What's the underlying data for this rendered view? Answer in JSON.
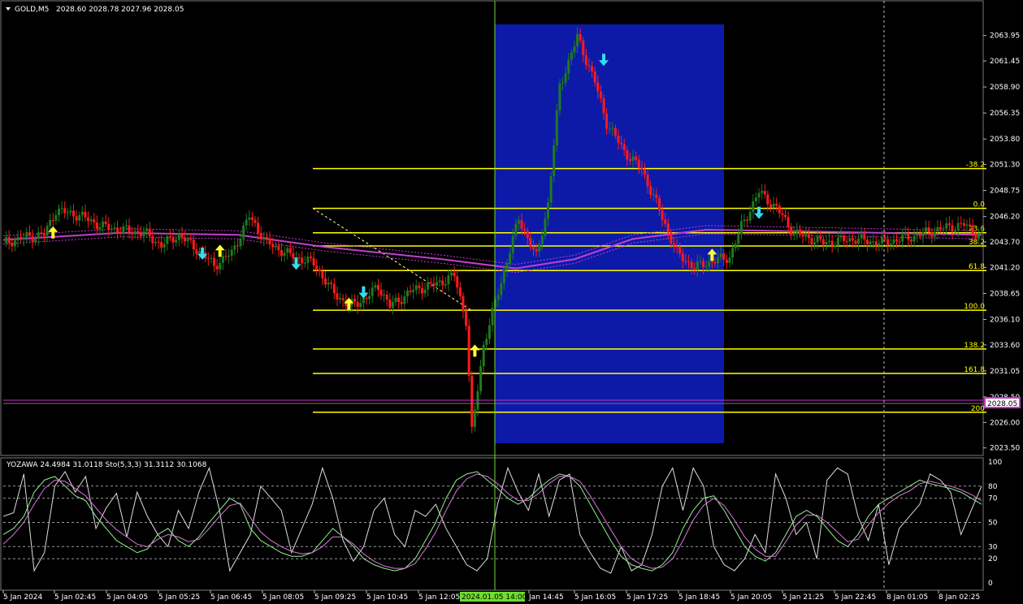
{
  "header": {
    "symbol_label": "GOLD,M5",
    "ohlc": "2028.60 2028.78 2027.96 2028.05"
  },
  "indicator": {
    "label": "YOZAWA 24.4984 31.0118  Sto(5,3,3) 31.3112 30.1068"
  },
  "price_badge": "2028.05",
  "colors": {
    "background": "#000000",
    "bull": "#1f7a1f",
    "bear": "#ff1a1a",
    "fib": "#ffff00",
    "box": "#0d1aa8",
    "ma": "#c040d0",
    "arrow_up": "#ffff33",
    "arrow_down": "#33ddee",
    "badge": "#cc33cc"
  },
  "chart_data": [
    {
      "type": "candlestick",
      "title": "GOLD,M5",
      "y_ticks": [
        "2063.95",
        "2061.45",
        "2058.90",
        "2056.35",
        "2053.80",
        "2051.30",
        "2048.75",
        "2046.20",
        "2043.70",
        "2041.20",
        "2038.65",
        "2036.10",
        "2033.60",
        "2031.05",
        "2028.50",
        "2026.00",
        "2023.50"
      ],
      "ylim": [
        2023.0,
        2065.2
      ],
      "x_ticks": [
        "5 Jan 2024",
        "5 Jan 02:45",
        "5 Jan 04:05",
        "5 Jan 05:25",
        "5 Jan 06:45",
        "5 Jan 08:05",
        "5 Jan 09:25",
        "5 Jan 10:45",
        "5 Jan 12:05",
        "2024.01.05 14:00",
        "Jan 14:45",
        "5 Jan 16:05",
        "5 Jan 17:25",
        "5 Jan 18:45",
        "5 Jan 20:05",
        "5 Jan 21:25",
        "5 Jan 22:45",
        "8 Jan 01:05",
        "8 Jan 02:25"
      ],
      "highlighted_x_tick": "2024.01.05 14:00",
      "current_price": 2028.05,
      "fib_levels": [
        {
          "label": "-38.2",
          "price": 2050.9
        },
        {
          "label": "0.0",
          "price": 2047.0
        },
        {
          "label": "23.6",
          "price": 2044.6
        },
        {
          "label": "38.2",
          "price": 2043.3
        },
        {
          "label": "61.8",
          "price": 2040.9
        },
        {
          "label": "100.0",
          "price": 2037.0
        },
        {
          "label": "138.2",
          "price": 2033.2
        },
        {
          "label": "161.8",
          "price": 2030.8
        },
        {
          "label": "200",
          "price": 2027.0
        }
      ],
      "price_path": [
        {
          "x": 0,
          "price": 2043.6
        },
        {
          "x": 8,
          "price": 2044.2
        },
        {
          "x": 14,
          "price": 2044.4
        },
        {
          "x": 18,
          "price": 2046.8
        },
        {
          "x": 26,
          "price": 2046.3
        },
        {
          "x": 34,
          "price": 2045.2
        },
        {
          "x": 42,
          "price": 2044.8
        },
        {
          "x": 48,
          "price": 2044.6
        },
        {
          "x": 54,
          "price": 2043.4
        },
        {
          "x": 60,
          "price": 2044.4
        },
        {
          "x": 66,
          "price": 2043.0
        },
        {
          "x": 72,
          "price": 2041.4
        },
        {
          "x": 78,
          "price": 2042.6
        },
        {
          "x": 84,
          "price": 2046.2
        },
        {
          "x": 90,
          "price": 2043.6
        },
        {
          "x": 98,
          "price": 2042.4
        },
        {
          "x": 106,
          "price": 2041.6
        },
        {
          "x": 112,
          "price": 2039.0
        },
        {
          "x": 118,
          "price": 2037.4
        },
        {
          "x": 124,
          "price": 2038.2
        },
        {
          "x": 128,
          "price": 2039.4
        },
        {
          "x": 132,
          "price": 2037.4
        },
        {
          "x": 140,
          "price": 2039.0
        },
        {
          "x": 148,
          "price": 2039.6
        },
        {
          "x": 154,
          "price": 2040.4
        },
        {
          "x": 158,
          "price": 2036.0
        },
        {
          "x": 160,
          "price": 2025.0
        },
        {
          "x": 164,
          "price": 2033.6
        },
        {
          "x": 170,
          "price": 2039.8
        },
        {
          "x": 176,
          "price": 2046.0
        },
        {
          "x": 182,
          "price": 2042.2
        },
        {
          "x": 186,
          "price": 2047.4
        },
        {
          "x": 190,
          "price": 2059.0
        },
        {
          "x": 196,
          "price": 2063.8
        },
        {
          "x": 202,
          "price": 2059.4
        },
        {
          "x": 206,
          "price": 2055.4
        },
        {
          "x": 212,
          "price": 2052.6
        },
        {
          "x": 218,
          "price": 2050.8
        },
        {
          "x": 224,
          "price": 2046.8
        },
        {
          "x": 230,
          "price": 2042.6
        },
        {
          "x": 236,
          "price": 2041.2
        },
        {
          "x": 242,
          "price": 2041.8
        },
        {
          "x": 248,
          "price": 2042.2
        },
        {
          "x": 252,
          "price": 2045.2
        },
        {
          "x": 258,
          "price": 2048.6
        },
        {
          "x": 264,
          "price": 2047.0
        },
        {
          "x": 270,
          "price": 2044.6
        },
        {
          "x": 280,
          "price": 2043.6
        },
        {
          "x": 290,
          "price": 2044.0
        },
        {
          "x": 300,
          "price": 2043.6
        },
        {
          "x": 310,
          "price": 2044.2
        },
        {
          "x": 320,
          "price": 2045.0
        },
        {
          "x": 328,
          "price": 2045.4
        },
        {
          "x": 334,
          "price": 2044.2
        }
      ],
      "ma_path": [
        {
          "x": 0,
          "price": 2043.9
        },
        {
          "x": 40,
          "price": 2044.6
        },
        {
          "x": 80,
          "price": 2044.4
        },
        {
          "x": 110,
          "price": 2043.2
        },
        {
          "x": 150,
          "price": 2042.0
        },
        {
          "x": 175,
          "price": 2041.1
        },
        {
          "x": 195,
          "price": 2042.0
        },
        {
          "x": 215,
          "price": 2044.0
        },
        {
          "x": 240,
          "price": 2044.9
        },
        {
          "x": 280,
          "price": 2044.7
        },
        {
          "x": 334,
          "price": 2044.4
        }
      ],
      "signals": [
        {
          "x": 17,
          "dir": "up",
          "price": 2044.6
        },
        {
          "x": 68,
          "dir": "down",
          "price": 2042.6
        },
        {
          "x": 74,
          "dir": "up",
          "price": 2042.8
        },
        {
          "x": 100,
          "dir": "down",
          "price": 2041.6
        },
        {
          "x": 118,
          "dir": "up",
          "price": 2037.6
        },
        {
          "x": 123,
          "dir": "down",
          "price": 2038.8
        },
        {
          "x": 161,
          "dir": "up",
          "price": 2033.0
        },
        {
          "x": 205,
          "dir": "down",
          "price": 2061.6
        },
        {
          "x": 242,
          "dir": "up",
          "price": 2042.4
        },
        {
          "x": 258,
          "dir": "down",
          "price": 2046.6
        }
      ]
    },
    {
      "type": "line",
      "title": "YOZAWA 24.4984 31.0118  Sto(5,3,3) 31.3112 30.1068",
      "y_ticks": [
        "100",
        "80",
        "70",
        "50",
        "30",
        "20",
        "0"
      ],
      "ylim": [
        0,
        100
      ],
      "levels": [
        80,
        70,
        50,
        30,
        20
      ],
      "series": [
        {
          "name": "white",
          "values": [
            55,
            58,
            90,
            10,
            25,
            80,
            92,
            75,
            88,
            45,
            62,
            74,
            38,
            75,
            55,
            40,
            30,
            60,
            45,
            75,
            95,
            60,
            10,
            25,
            40,
            80,
            70,
            60,
            25,
            45,
            65,
            95,
            70,
            35,
            18,
            30,
            60,
            70,
            40,
            30,
            60,
            55,
            65,
            45,
            30,
            15,
            10,
            20,
            65,
            95,
            75,
            60,
            90,
            55,
            85,
            90,
            40,
            25,
            12,
            8,
            30,
            10,
            15,
            40,
            80,
            95,
            60,
            95,
            80,
            30,
            15,
            10,
            20,
            40,
            25,
            90,
            70,
            40,
            50,
            20,
            85,
            95,
            90,
            55,
            35,
            65,
            15,
            45,
            55,
            65,
            90,
            85,
            75,
            40,
            60,
            80
          ]
        },
        {
          "name": "green",
          "values": [
            40,
            45,
            55,
            75,
            85,
            88,
            80,
            72,
            68,
            55,
            45,
            35,
            30,
            25,
            28,
            40,
            45,
            35,
            30,
            38,
            50,
            60,
            70,
            65,
            45,
            35,
            30,
            25,
            22,
            22,
            25,
            35,
            45,
            38,
            30,
            20,
            15,
            12,
            10,
            12,
            20,
            35,
            50,
            70,
            85,
            90,
            92,
            85,
            78,
            70,
            65,
            70,
            78,
            85,
            90,
            88,
            80,
            65,
            50,
            35,
            22,
            15,
            12,
            10,
            15,
            25,
            45,
            60,
            70,
            72,
            60,
            45,
            30,
            22,
            18,
            25,
            40,
            55,
            60,
            55,
            45,
            35,
            30,
            40,
            55,
            65,
            70,
            75,
            80,
            85,
            82,
            80,
            78,
            75,
            70,
            65
          ]
        },
        {
          "name": "magenta",
          "values": [
            32,
            40,
            50,
            65,
            78,
            85,
            84,
            78,
            72,
            62,
            52,
            44,
            38,
            32,
            30,
            36,
            40,
            38,
            34,
            36,
            45,
            55,
            64,
            66,
            54,
            42,
            35,
            30,
            26,
            24,
            25,
            30,
            38,
            38,
            32,
            24,
            18,
            14,
            12,
            12,
            16,
            28,
            42,
            60,
            76,
            86,
            90,
            88,
            82,
            74,
            68,
            68,
            74,
            82,
            88,
            88,
            84,
            72,
            58,
            44,
            30,
            20,
            15,
            12,
            13,
            20,
            35,
            52,
            64,
            70,
            64,
            52,
            38,
            28,
            22,
            22,
            34,
            48,
            56,
            56,
            50,
            42,
            34,
            36,
            48,
            58,
            66,
            72,
            76,
            82,
            84,
            82,
            80,
            77,
            73,
            68
          ]
        }
      ]
    }
  ]
}
